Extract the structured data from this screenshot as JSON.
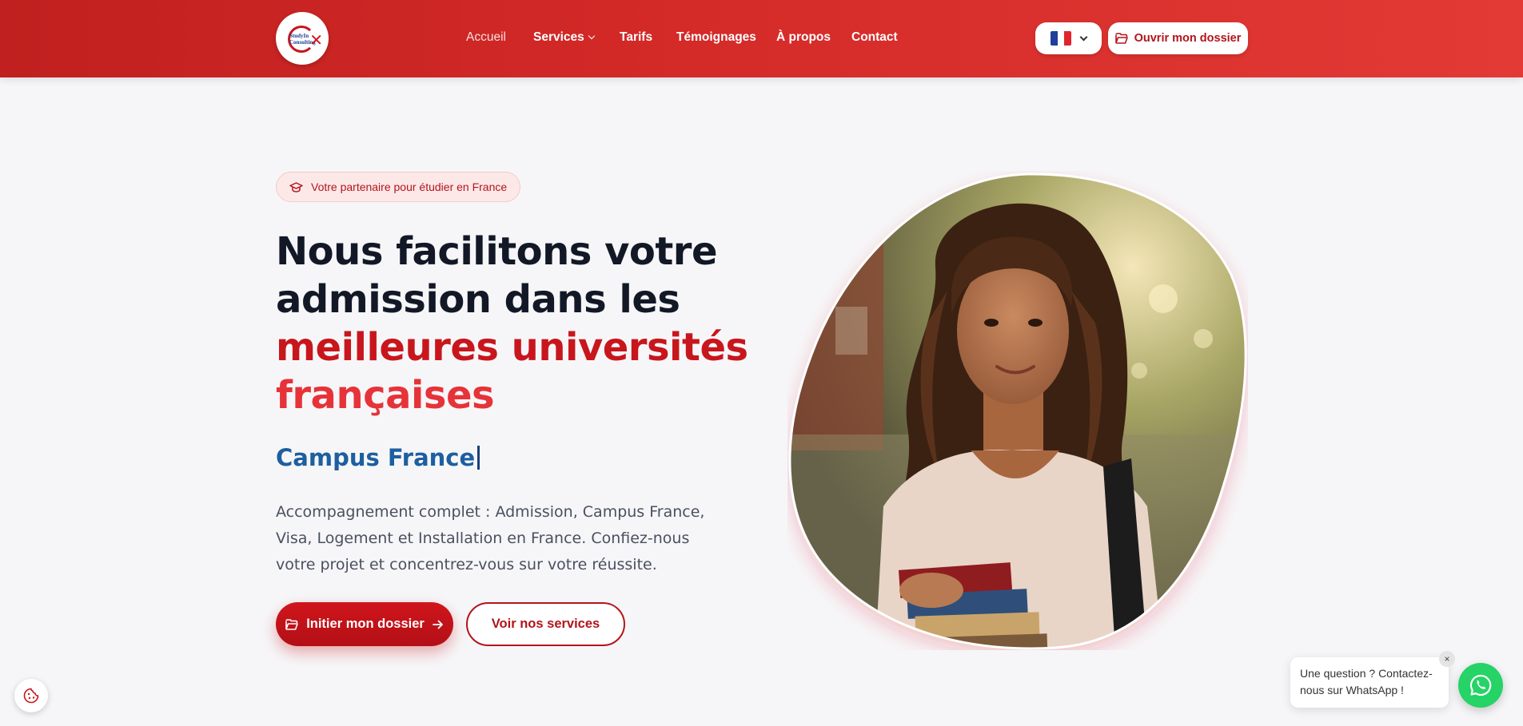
{
  "header": {
    "logo_text": "StudyIn Consulting",
    "nav": [
      {
        "label": "Accueil",
        "active": true
      },
      {
        "label": "Services",
        "dropdown": true
      },
      {
        "label": "Tarifs"
      },
      {
        "label": "Témoignages"
      },
      {
        "label": "À propos"
      },
      {
        "label": "Contact"
      }
    ],
    "language": {
      "flag": "fr",
      "icon": "chevron-down-icon"
    },
    "open_file_button": {
      "label": "Ouvrir mon dossier",
      "icon": "folder-open-icon"
    }
  },
  "hero": {
    "badge": {
      "icon": "graduation-cap-icon",
      "label": "Votre partenaire pour étudier en France"
    },
    "headline_line1": "Nous facilitons votre",
    "headline_line2": "admission dans les",
    "headline_highlight1": "meilleures universités",
    "headline_highlight2": "françaises",
    "typed_text": "Campus France",
    "description": "Accompagnement complet : Admission, Campus France, Visa, Logement et Installation en France. Confiez-nous votre projet et concentrez-vous sur votre réussite.",
    "primary_cta": {
      "label": "Initier mon dossier",
      "icon": "folder-open-icon",
      "trailing_icon": "arrow-right-icon"
    },
    "secondary_cta": {
      "label": "Voir nos services"
    }
  },
  "cookie_button": {
    "icon": "cookie-icon"
  },
  "whatsapp": {
    "bubble_text": "Une question ? Contactez-nous sur WhatsApp !",
    "close_label": "×",
    "icon": "whatsapp-icon"
  },
  "colors": {
    "brand_red": "#c8161d",
    "header_gradient_start": "#c0201f",
    "header_gradient_end": "#e43a36",
    "typed_blue": "#1d5fa0",
    "whatsapp_green": "#25d366"
  }
}
